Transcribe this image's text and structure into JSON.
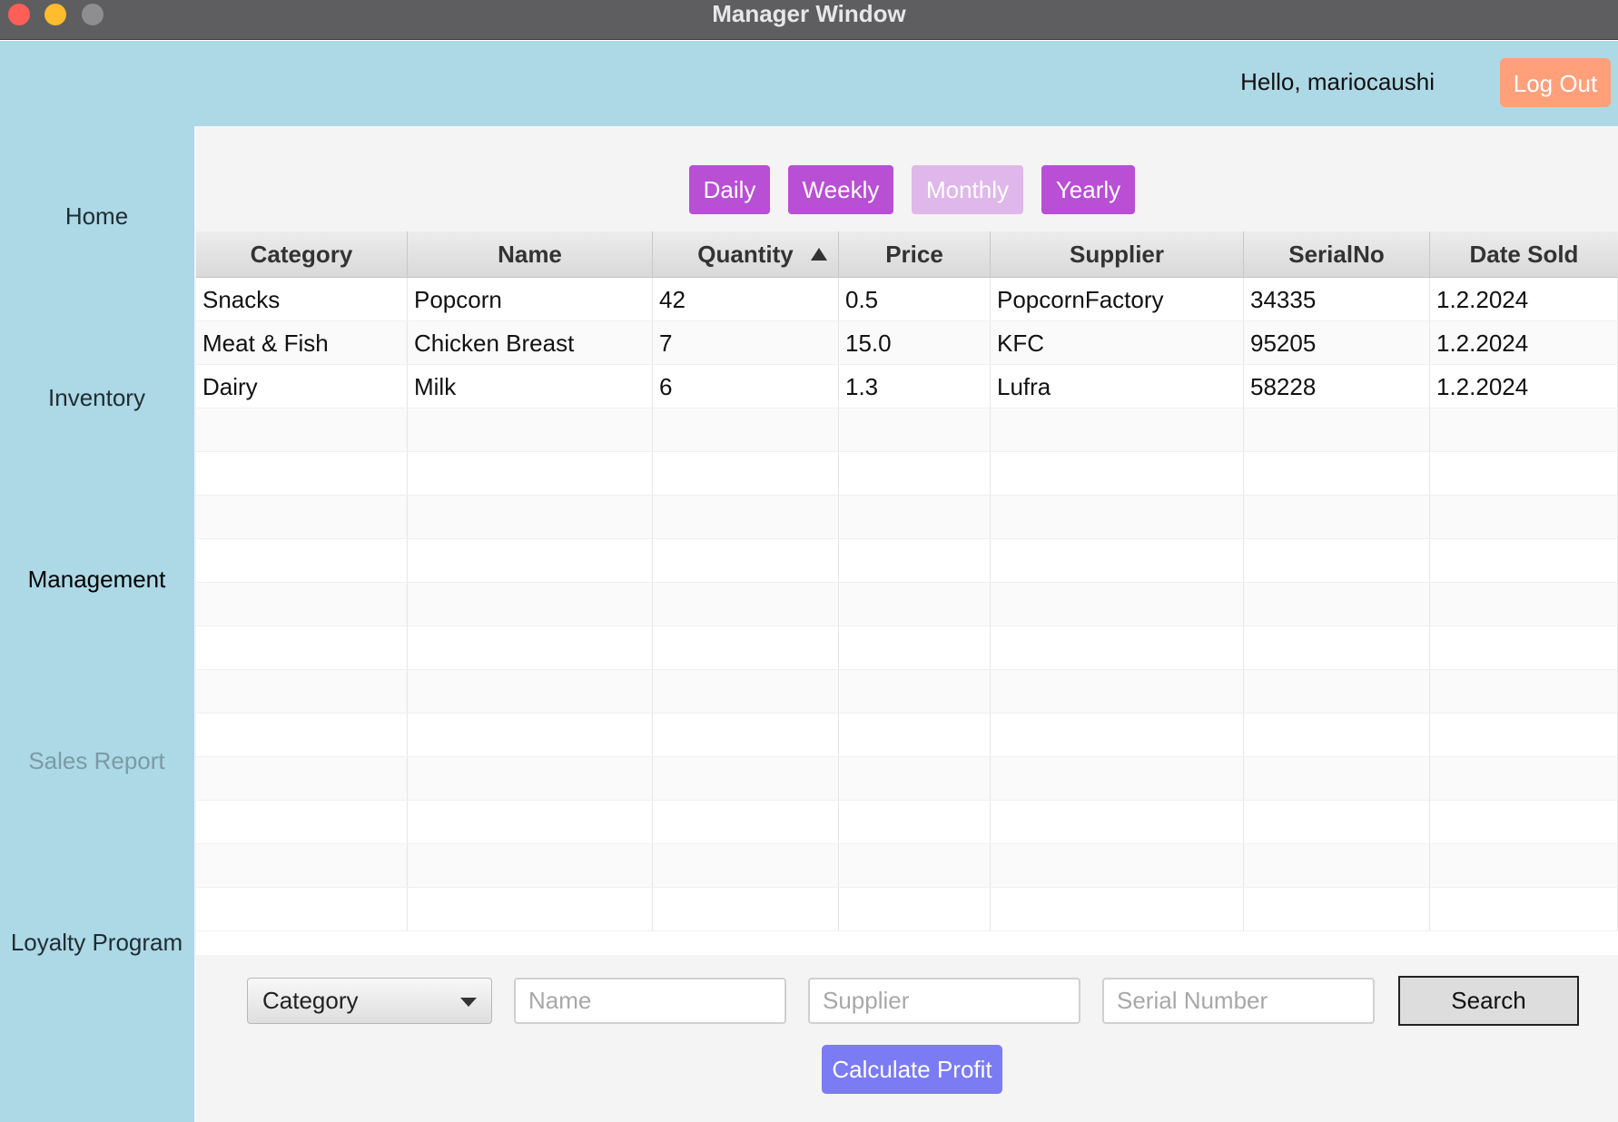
{
  "window": {
    "title": "Manager Window"
  },
  "header": {
    "greeting": "Hello, mariocaushi",
    "logout_label": "Log Out"
  },
  "sidebar": {
    "items": [
      {
        "label": "Home",
        "state": "normal"
      },
      {
        "label": "Inventory",
        "state": "normal"
      },
      {
        "label": "Management",
        "state": "active"
      },
      {
        "label": "Sales Report",
        "state": "disabled"
      },
      {
        "label": "Loyalty Program",
        "state": "normal"
      }
    ]
  },
  "periods": [
    {
      "label": "Daily",
      "enabled": true
    },
    {
      "label": "Weekly",
      "enabled": true
    },
    {
      "label": "Monthly",
      "enabled": false
    },
    {
      "label": "Yearly",
      "enabled": true
    }
  ],
  "table": {
    "columns": [
      "Category",
      "Name",
      "Quantity",
      "Price",
      "Supplier",
      "SerialNo",
      "Date Sold"
    ],
    "sorted_column": "Quantity",
    "sort_direction": "ascending",
    "rows": [
      [
        "Snacks",
        "Popcorn",
        "42",
        "0.5",
        "PopcornFactory",
        "34335",
        "1.2.2024"
      ],
      [
        "Meat & Fish",
        "Chicken Breast",
        "7",
        "15.0",
        "KFC",
        "95205",
        "1.2.2024"
      ],
      [
        "Dairy",
        "Milk",
        "6",
        "1.3",
        "Lufra",
        "58228",
        "1.2.2024"
      ]
    ]
  },
  "filters": {
    "category_select": "Category",
    "name_placeholder": "Name",
    "supplier_placeholder": "Supplier",
    "serial_placeholder": "Serial Number",
    "search_label": "Search"
  },
  "actions": {
    "calculate_profit_label": "Calculate Profit"
  },
  "colors": {
    "sidebar_bg": "#add8e6",
    "logout_bg": "#ffa07a",
    "period_button": "#b84fd4",
    "period_button_disabled": "#dfb7ea",
    "calculate_button": "#7b7bf4"
  }
}
